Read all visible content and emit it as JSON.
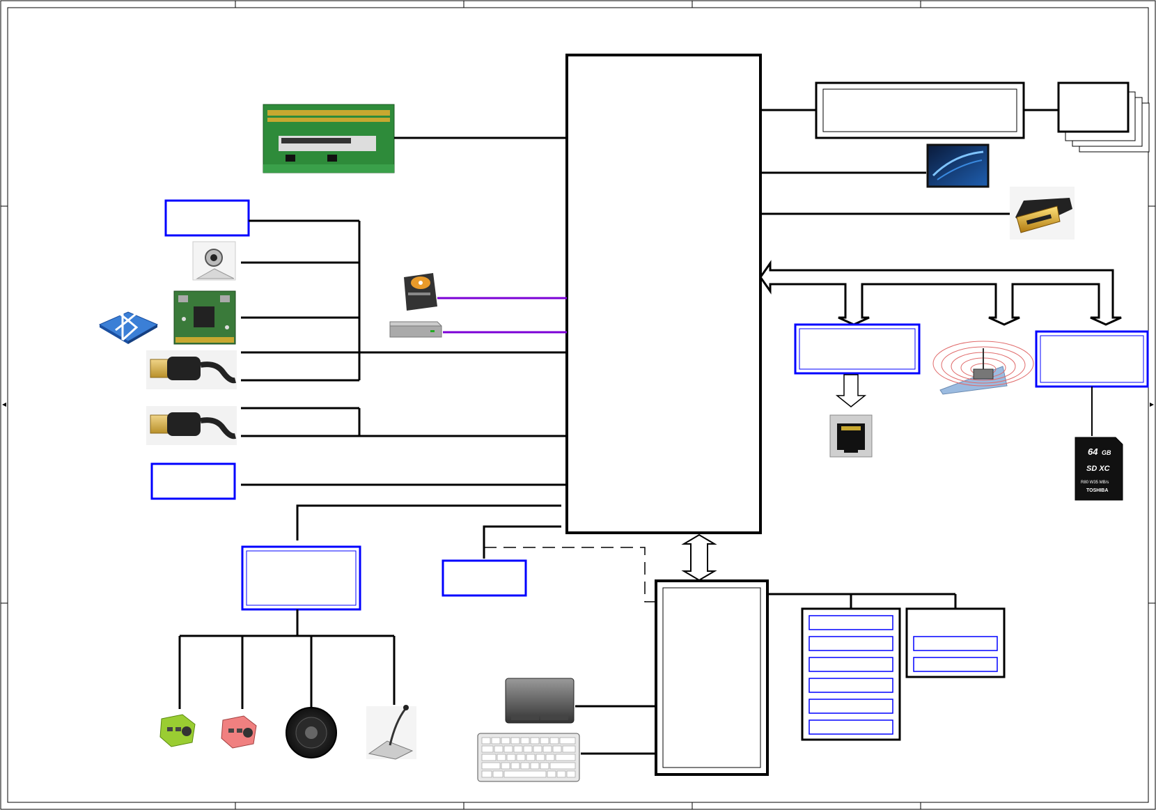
{
  "colors": {
    "line": "#000000",
    "box_blue": "#0000ff",
    "sata_purple": "#7b00d6",
    "background": "#ffffff",
    "border": "#000000"
  },
  "icons": [
    "memory-module-icon",
    "webcam-icon",
    "bluetooth-icon",
    "wireless-card-icon",
    "usb-plug-icon",
    "hard-disk-icon",
    "optical-drive-icon",
    "lcd-panel-icon",
    "hdmi-connector-icon",
    "wireless-antenna-icon",
    "rj45-port-icon",
    "sd-card-icon",
    "headphone-jack-icon",
    "microphone-jack-icon",
    "speaker-icon",
    "desk-microphone-icon",
    "touchpad-icon",
    "keyboard-icon"
  ],
  "sd_card": {
    "capacity": "64",
    "unit": "GB",
    "type": "SD XC",
    "speed": "R80 W35 MB/s",
    "brand": "TOSHIBA"
  }
}
